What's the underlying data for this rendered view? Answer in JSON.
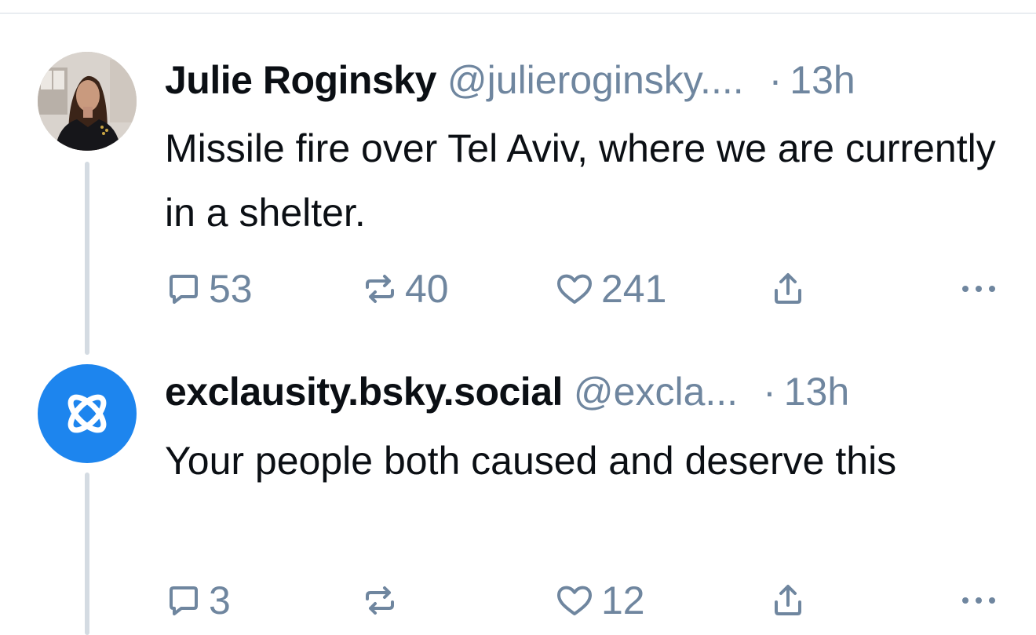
{
  "posts": [
    {
      "author_name": "Julie Roginsky",
      "handle": "@julieroginsky....",
      "separator": "·",
      "time": "13h",
      "text": "Missile fire over Tel Aviv, where we are currently in a shelter.",
      "avatar": "photo-avatar",
      "actions": {
        "replies": "53",
        "reposts": "40",
        "likes": "241"
      }
    },
    {
      "author_name": "exclausity.bsky.social",
      "handle": "@excla...",
      "separator": "·",
      "time": "13h",
      "text": "Your people both caused and deserve this",
      "avatar": "bluesky-butterfly-icon",
      "actions": {
        "replies": "3",
        "reposts": "",
        "likes": "12"
      }
    }
  ],
  "colors": {
    "text": "#0b0f14",
    "muted": "#6f869f",
    "thread_line": "#d4dbe2",
    "default_avatar": "#1d85ee"
  },
  "icons": [
    "reply-icon",
    "repost-icon",
    "like-icon",
    "share-icon",
    "more-icon"
  ]
}
